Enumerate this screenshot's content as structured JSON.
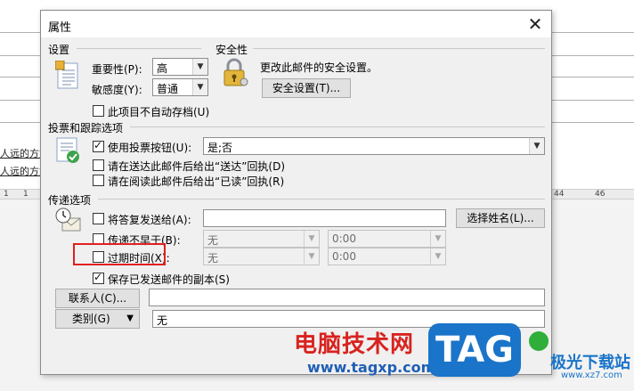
{
  "background": {
    "doc_text_1": "人远的方式",
    "doc_text_2": "人远的方式",
    "ruler_marks": [
      "44",
      "46"
    ],
    "ruler_marks_left": [
      "1",
      "1"
    ]
  },
  "dialog": {
    "title": "属性",
    "close_glyph": "✕",
    "settings": {
      "group_title": "设置",
      "importance_label": "重要性(P):",
      "importance_value": "高",
      "sensitivity_label": "敏感度(Y):",
      "sensitivity_value": "普通",
      "no_autoarchive_label": "此项目不自动存档(U)"
    },
    "security": {
      "group_title": "安全性",
      "description": "更改此邮件的安全设置。",
      "button_label": "安全设置(T)..."
    },
    "voting": {
      "group_title": "投票和跟踪选项",
      "use_voting_label": "使用投票按钮(U):",
      "use_voting_checked": true,
      "voting_value": "是;否",
      "delivery_receipt_label": "请在送达此邮件后给出“送达”回执(D)",
      "read_receipt_label": "请在阅读此邮件后给出“已读”回执(R)"
    },
    "delivery": {
      "group_title": "传递选项",
      "reply_to_label": "将答复发送给(A):",
      "reply_to_value": "",
      "select_names_button": "选择姓名(L)...",
      "not_before_label": "传递不早于(B):",
      "not_before_date": "无",
      "not_before_time": "0:00",
      "expires_label": "过期时间(X):",
      "expires_date": "无",
      "expires_time": "0:00",
      "save_copy_label": "保存已发送邮件的副本(S)",
      "save_copy_checked": true
    },
    "contacts_button": "联系人(C)...",
    "contacts_value": "",
    "categories_button": "类别(G)",
    "categories_value": "无"
  },
  "watermark": {
    "brand_text": "电脑技术网",
    "brand_url": "www.tagxp.com",
    "tag_text": "TAG",
    "site_name": "极光下载站",
    "site_url": "www.xz7.com"
  },
  "colors": {
    "dialog_bg": "#f0f0f0",
    "highlight_red": "#e02020",
    "watermark_red": "#d8231f",
    "watermark_blue": "#1a74c9"
  }
}
